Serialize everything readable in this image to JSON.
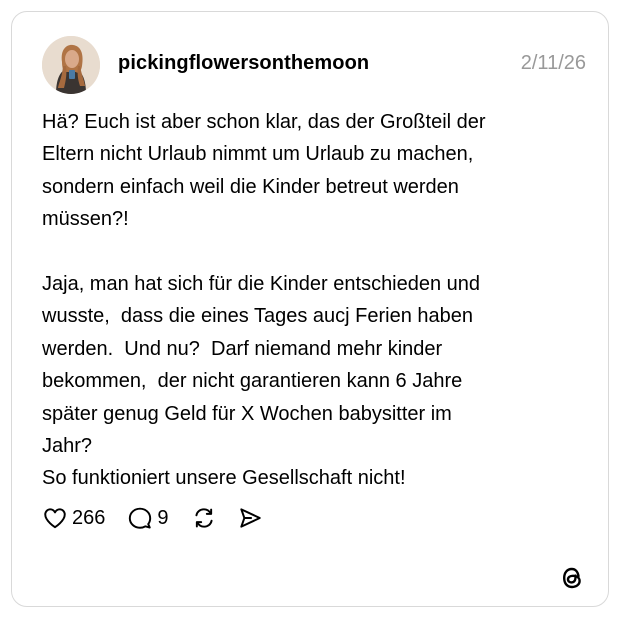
{
  "post": {
    "username": "pickingflowersonthemoon",
    "date": "2/11/26",
    "text": "Hä? Euch ist aber schon klar, das der Großteil der\nEltern nicht Urlaub nimmt um Urlaub zu machen,\nsondern einfach weil die Kinder betreut werden\nmüssen?!\n\nJaja, man hat sich für die Kinder entschieden und\nwusste,  dass die eines Tages aucj Ferien haben\nwerden.  Und nu?  Darf niemand mehr kinder\nbekommen,  der nicht garantieren kann 6 Jahre\nspäter genug Geld für X Wochen babysitter im\nJahr?\nSo funktioniert unsere Gesellschaft nicht!"
  },
  "actions": {
    "likes": "266",
    "replies": "9"
  },
  "icons": {
    "like": "heart-icon",
    "reply": "comment-bubble-icon",
    "repost": "repost-icon",
    "share": "send-icon",
    "brand": "threads-logo-icon"
  },
  "colors": {
    "date": "#999999",
    "border": "#d9d9d9"
  }
}
